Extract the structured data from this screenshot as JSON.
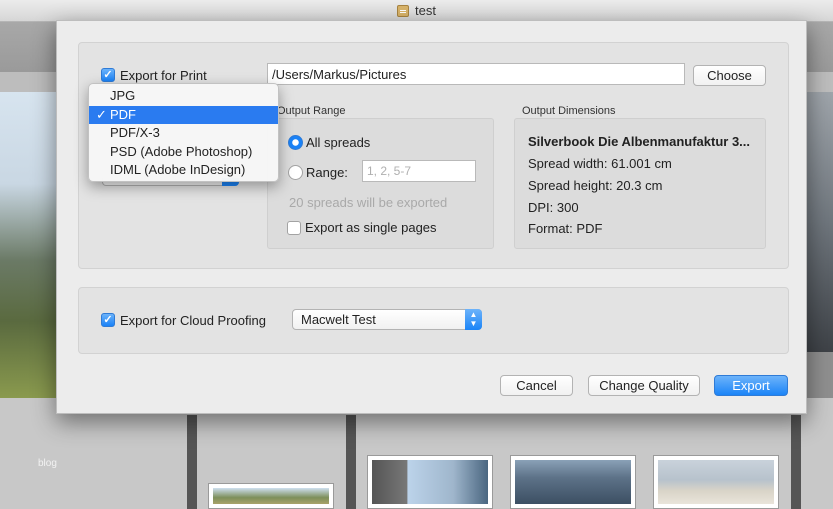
{
  "window": {
    "title": "test"
  },
  "background": {
    "blog_label": "blog"
  },
  "export_print": {
    "checkbox_label": "Export for Print",
    "path": "/Users/Markus/Pictures",
    "choose_label": "Choose",
    "format_options": [
      "JPG",
      "PDF",
      "PDF/X-3",
      "PSD (Adobe Photoshop)",
      "IDML (Adobe InDesign)"
    ],
    "selected_format": "PDF",
    "check_mark": "✓"
  },
  "output_range": {
    "heading": "Output Range",
    "all_spreads_label": "All spreads",
    "range_label": "Range:",
    "range_placeholder": "1, 2, 5-7",
    "spreads_info": "20 spreads will be exported",
    "single_pages_label": "Export as single pages"
  },
  "output_dimensions": {
    "heading": "Output Dimensions",
    "name": "Silverbook Die Albenmanufaktur 3...",
    "spread_width": "Spread width: 61.001 cm",
    "spread_height": "Spread height: 20.3 cm",
    "dpi": "DPI: 300",
    "format": "Format: PDF"
  },
  "cloud": {
    "checkbox_label": "Export for Cloud Proofing",
    "selected": "Macwelt Test"
  },
  "buttons": {
    "cancel": "Cancel",
    "change_quality": "Change Quality",
    "export": "Export"
  }
}
